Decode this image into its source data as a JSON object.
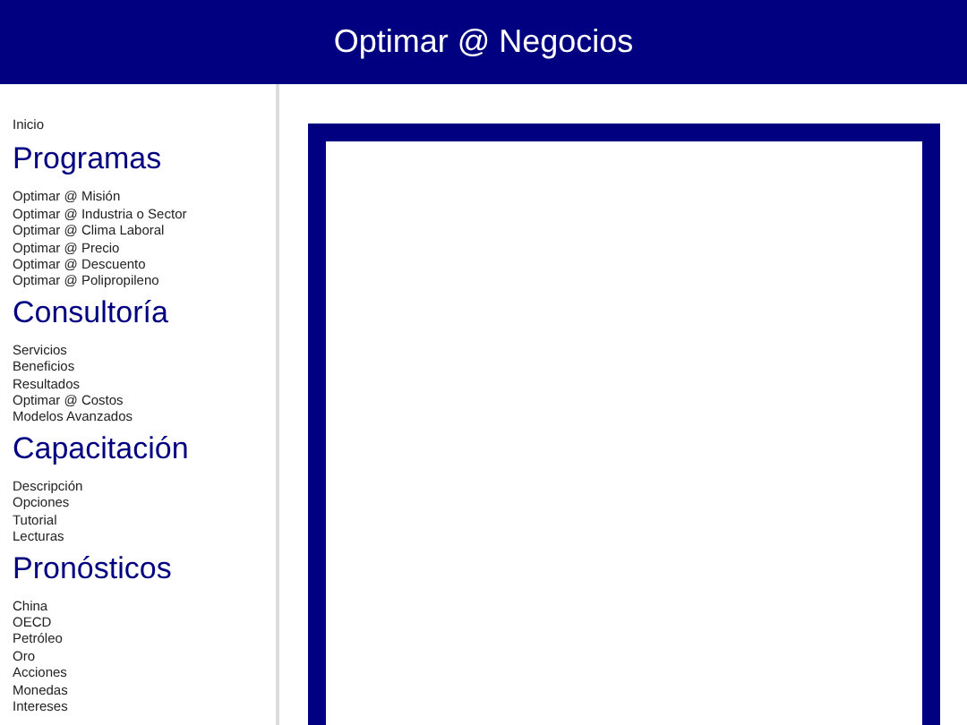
{
  "header": {
    "title": "Optimar @ Negocios"
  },
  "sidebar": {
    "home_link": "Inicio",
    "sections": [
      {
        "title": "Programas",
        "items": [
          "Optimar @ Misión",
          "Optimar @ Industria o Sector",
          "Optimar @ Clima Laboral",
          "Optimar @ Precio",
          "Optimar @ Descuento",
          "Optimar @ Polipropileno"
        ]
      },
      {
        "title": "Consultoría",
        "items": [
          "Servicios",
          "Beneficios",
          "Resultados",
          "Optimar @ Costos",
          "Modelos Avanzados"
        ]
      },
      {
        "title": "Capacitación",
        "items": [
          "Descripción",
          "Opciones",
          "Tutorial",
          "Lecturas"
        ]
      },
      {
        "title": "Pronósticos",
        "items": [
          "China",
          "OECD",
          "Petróleo",
          "Oro",
          "Acciones",
          "Monedas",
          "Intereses"
        ]
      }
    ]
  }
}
